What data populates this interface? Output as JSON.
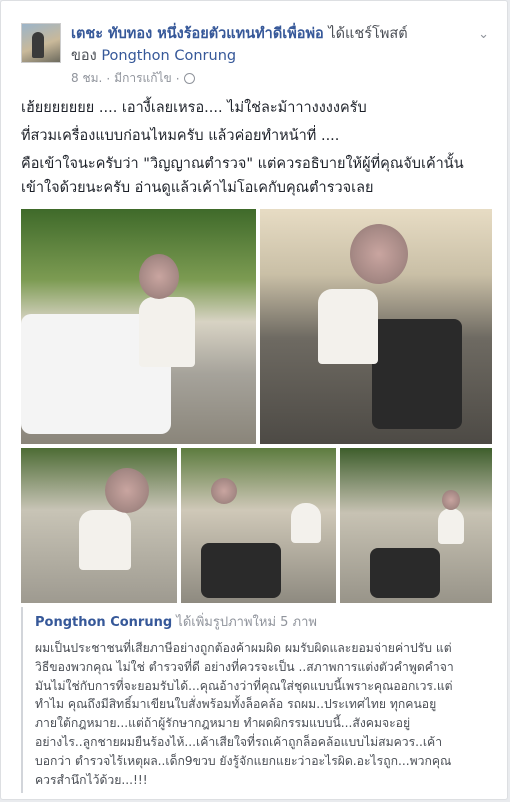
{
  "header": {
    "author": "เตชะ ทับทอง หนึ่งร้อยตัวแทนทำดีเพื่อพ่อ",
    "action": "ได้แชร์โพสต์",
    "of_label": "ของ",
    "original_author": "Pongthon Conrung",
    "time": "8 ชม.",
    "edited": "มีการแก้ไข",
    "separator": "·"
  },
  "post_lines": [
    "เฮ้ยยยยยยย .... เอางี้เลยเหรอ.... ไม่ใช่ละม้าาางงงงครับ",
    "ที่สวมเครื่องแบบก่อนไหมครับ แล้วค่อยทำหน้าที่ ....",
    "คือเข้าใจนะครับว่า \"วิญญาณตำรวจ\" แต่ควรอธิบายให้ผู้ที่คุณจับเค้านั้น",
    "เข้าใจด้วยนะครับ อ่านดูแล้วเค้าไม่โอเคกับคุณตำรวจเลย"
  ],
  "photos": [
    {
      "name": "photo-1",
      "icon": "photo-man-car"
    },
    {
      "name": "photo-2",
      "icon": "photo-man-motorbike"
    },
    {
      "name": "photo-3",
      "icon": "photo-man-officer"
    },
    {
      "name": "photo-4",
      "icon": "photo-officer-bike"
    },
    {
      "name": "photo-5",
      "icon": "photo-street-scene"
    }
  ],
  "shared": {
    "name": "Pongthon Conrung",
    "action": "ได้เพิ่มรูปภาพใหม่ 5 ภาพ",
    "lines": [
      "ผมเป็นประชาชนที่เสียภาษีอย่างถูกต้องค้าผมผิด ผมรับผิดและยอมจ่ายค่าปรับ แต่",
      "วิธีของพวกคุณ ไม่ใช่ ตำรวจที่ดี อย่างที่ควรจะเป็น ..สภาพการแต่งตัวคำพูดคำจา",
      "มันไม่ใช่กับการที่จะยอมรับได้...คุณอ้างว่าที่คุณใส่ชุดแบบนี้เพราะคุณออกเวร.แต่",
      "ทำไม คุณถึงมีสิทธิ์มาเขียนใบสั่งพร้อมทั้งล็อคล้อ รถผม..ประเทศไทย ทุกคนอยู",
      "ภายใต้กฎหมาย...แต่ถ้าผู้รักษากฎหมาย ทำผดผิกรรมแบบนี้...สังคมจะอยู่",
      "อย่างไร..ลูกชายผมยืนร้องไห้...เค้าเสียใจที่รถเค้าถูกล็อคล้อแบบไม่สมควร..เค้า",
      "บอกว่า ตำรวจไร้เหตุผล..เด็ก9ขวบ ยังรู้จักแยกแยะว่าอะไรผิด.อะไรถูก...พวกคุณ",
      "ควรสำนึกไว้ด้วย...!!!"
    ]
  },
  "colors": {
    "link": "#365899",
    "meta": "#90949c",
    "text": "#1d2129"
  }
}
